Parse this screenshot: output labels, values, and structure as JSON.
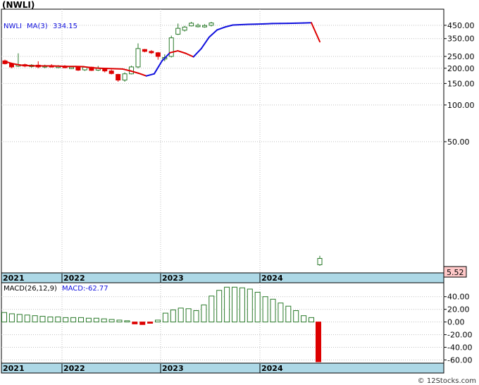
{
  "title": "(NWLI)",
  "credit": "© 12Stocks.com",
  "colors": {
    "up": "#2a7a2a",
    "down": "#dd0000",
    "ma": "#1010dd",
    "datebar": "#add8e6",
    "grid": "#c0c0c0",
    "price_box": "#ffc8c8"
  },
  "chart_data": [
    {
      "type": "line",
      "panel": "price",
      "legend": {
        "symbol": "NWLI",
        "ma_label": "MA(3)",
        "ma_value": "334.15"
      },
      "y_scale": "log",
      "ylim": [
        4.2,
        610
      ],
      "y_ticks": [
        {
          "value": 450,
          "label": "450.00"
        },
        {
          "value": 350,
          "label": "350.00"
        },
        {
          "value": 250,
          "label": "250.00"
        },
        {
          "value": 200,
          "label": "200.00"
        },
        {
          "value": 150,
          "label": "150.00"
        },
        {
          "value": 100,
          "label": "100.00"
        },
        {
          "value": 50,
          "label": "50.00"
        }
      ],
      "last_price_label": "5.52",
      "x_tick_labels": [
        "2021",
        "2022",
        "2023",
        "2024"
      ],
      "candles": [
        {
          "o": 230,
          "h": 235,
          "l": 215,
          "c": 218
        },
        {
          "o": 218,
          "h": 222,
          "l": 200,
          "c": 205
        },
        {
          "o": 208,
          "h": 265,
          "l": 205,
          "c": 214
        },
        {
          "o": 214,
          "h": 218,
          "l": 204,
          "c": 209
        },
        {
          "o": 208,
          "h": 216,
          "l": 202,
          "c": 212
        },
        {
          "o": 212,
          "h": 228,
          "l": 200,
          "c": 205
        },
        {
          "o": 205,
          "h": 214,
          "l": 200,
          "c": 210
        },
        {
          "o": 210,
          "h": 216,
          "l": 204,
          "c": 206
        },
        {
          "o": 206,
          "h": 212,
          "l": 200,
          "c": 208
        },
        {
          "o": 208,
          "h": 212,
          "l": 200,
          "c": 202
        },
        {
          "o": 202,
          "h": 206,
          "l": 197,
          "c": 204
        },
        {
          "o": 204,
          "h": 206,
          "l": 190,
          "c": 193
        },
        {
          "o": 194,
          "h": 208,
          "l": 190,
          "c": 204
        },
        {
          "o": 204,
          "h": 206,
          "l": 190,
          "c": 192
        },
        {
          "o": 193,
          "h": 209,
          "l": 190,
          "c": 200
        },
        {
          "o": 200,
          "h": 202,
          "l": 185,
          "c": 190
        },
        {
          "o": 190,
          "h": 195,
          "l": 178,
          "c": 181
        },
        {
          "o": 178,
          "h": 180,
          "l": 155,
          "c": 160
        },
        {
          "o": 160,
          "h": 185,
          "l": 155,
          "c": 180
        },
        {
          "o": 180,
          "h": 210,
          "l": 178,
          "c": 205
        },
        {
          "o": 205,
          "h": 320,
          "l": 200,
          "c": 290
        },
        {
          "o": 285,
          "h": 288,
          "l": 270,
          "c": 275
        },
        {
          "o": 275,
          "h": 282,
          "l": 262,
          "c": 268
        },
        {
          "o": 268,
          "h": 272,
          "l": 235,
          "c": 250
        },
        {
          "o": 238,
          "h": 260,
          "l": 228,
          "c": 245
        },
        {
          "o": 250,
          "h": 370,
          "l": 245,
          "c": 355
        },
        {
          "o": 380,
          "h": 465,
          "l": 375,
          "c": 425
        },
        {
          "o": 410,
          "h": 445,
          "l": 400,
          "c": 435
        },
        {
          "o": 445,
          "h": 480,
          "l": 440,
          "c": 468
        },
        {
          "o": 445,
          "h": 465,
          "l": 432,
          "c": 450
        },
        {
          "o": 440,
          "h": 460,
          "l": 430,
          "c": 448
        },
        {
          "o": 450,
          "h": 480,
          "l": 440,
          "c": 470
        },
        {
          "o": 4.9,
          "h": 5.8,
          "l": 4.8,
          "c": 5.52
        }
      ],
      "ma_line": [
        227,
        218,
        212,
        210,
        209,
        209,
        209,
        208,
        207,
        207,
        206,
        202,
        200,
        199,
        198,
        197,
        190,
        182,
        173,
        180,
        230,
        268,
        278,
        265,
        248,
        290,
        360,
        412,
        435,
        452,
        455,
        458,
        460,
        462,
        465,
        466,
        467,
        468,
        470,
        472,
        330
      ],
      "ma_line_colors": [
        "down",
        "down",
        "down",
        "down",
        "down",
        "down",
        "down",
        "down",
        "down",
        "down",
        "down",
        "down",
        "down",
        "down",
        "down",
        "down",
        "down",
        "down",
        "down",
        "up",
        "up",
        "up",
        "down",
        "down",
        "down",
        "up",
        "up",
        "up",
        "up",
        "up",
        "up",
        "up",
        "up",
        "up",
        "up",
        "up",
        "up",
        "up",
        "up",
        "up",
        "down"
      ]
    },
    {
      "type": "bar",
      "panel": "macd",
      "legend": {
        "label": "MACD(26,12,9)",
        "value_label": "MACD:-62.77"
      },
      "ylim": [
        -65,
        62
      ],
      "y_ticks": [
        {
          "value": 40,
          "label": "40.00"
        },
        {
          "value": 20,
          "label": "20.00"
        },
        {
          "value": 0,
          "label": "0.00"
        },
        {
          "value": -20,
          "label": "-20.00"
        },
        {
          "value": -40,
          "label": "-40.00"
        },
        {
          "value": -60,
          "label": "-60.00"
        }
      ],
      "x_tick_labels": [
        "2021",
        "2022",
        "2023",
        "2024"
      ],
      "values": [
        15,
        13,
        12,
        11,
        10,
        9,
        8,
        8,
        7,
        7,
        7,
        6,
        6,
        5,
        4,
        3,
        2,
        -3,
        -4,
        -2,
        3,
        14,
        19,
        22,
        21,
        18,
        27,
        41,
        50,
        55,
        55,
        54,
        52,
        47,
        40,
        36,
        30,
        25,
        18,
        10,
        7,
        -62.77
      ]
    }
  ]
}
